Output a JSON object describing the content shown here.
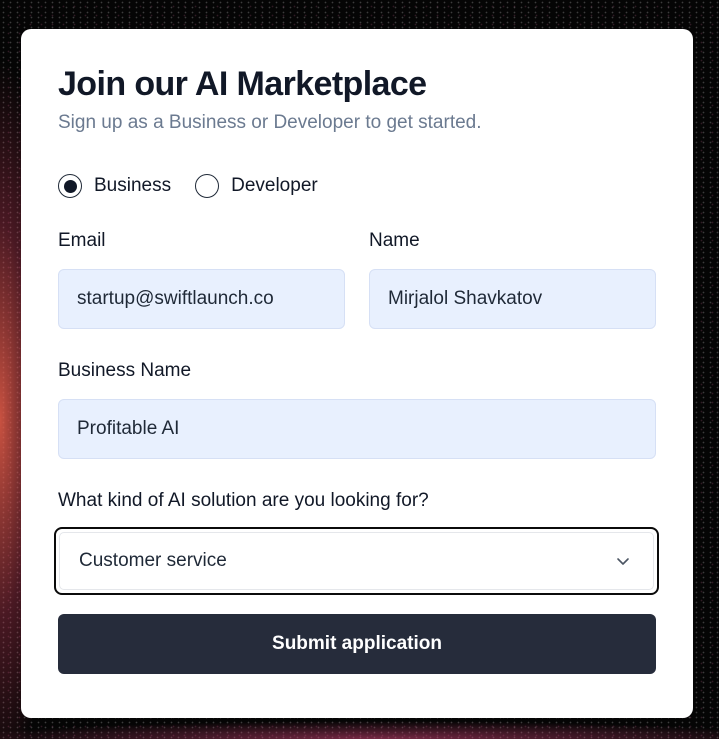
{
  "form": {
    "title": "Join our AI Marketplace",
    "subtitle": "Sign up as a Business or Developer to get started.",
    "roles": [
      {
        "label": "Business",
        "selected": true
      },
      {
        "label": "Developer",
        "selected": false
      }
    ],
    "email": {
      "label": "Email",
      "value": "startup@swiftlaunch.co"
    },
    "name": {
      "label": "Name",
      "value": "Mirjalol Shavkatov"
    },
    "business_name": {
      "label": "Business Name",
      "value": "Profitable AI"
    },
    "solution": {
      "label": "What kind of AI solution are you looking for?",
      "selected": "Customer service",
      "icon": "chevron-down-icon"
    },
    "submit_label": "Submit application"
  },
  "colors": {
    "accent": "#262c3b",
    "input_background": "#e8f0fe",
    "subtitle": "#6b7a90",
    "title": "#111827"
  }
}
